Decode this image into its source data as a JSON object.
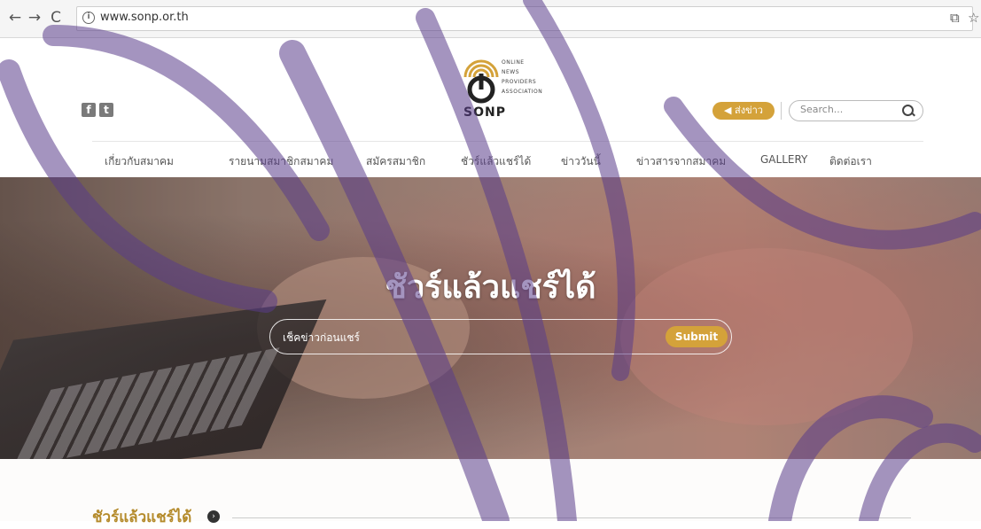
{
  "browser": {
    "url": "www.sonp.or.th",
    "back_icon": "←",
    "forward_icon": "→",
    "reload_icon": "C",
    "translate_icon": "⧉",
    "star_icon": "☆"
  },
  "header": {
    "social": [
      "f",
      "t"
    ],
    "logo_lines": [
      "ONLINE",
      "NEWS",
      "PROVIDERS",
      "ASSOCIATION"
    ],
    "logo_word": "SONP",
    "send_news_label": "◀ ส่งข่าว",
    "search_placeholder": "Search..."
  },
  "menu": [
    "เกี่ยวกับสมาคม",
    "รายนามสมาชิกสมาคม",
    "สมัครสมาชิก",
    "ชัวร์แล้วแชร์ได้",
    "ข่าววันนี้",
    "ข่าวสารจากสมาคม",
    "GALLERY",
    "ติดต่อเรา"
  ],
  "hero": {
    "title": "ชัวร์แล้วแชร์ได้",
    "input_placeholder": "เช็คข่าวก่อนแชร์",
    "submit_label": "Submit"
  },
  "section": {
    "title": "ชัวร์แล้วแชร์ได้"
  },
  "colors": {
    "accent_gold": "#d4a23a",
    "watermark_purple": "#5a3d8a"
  }
}
